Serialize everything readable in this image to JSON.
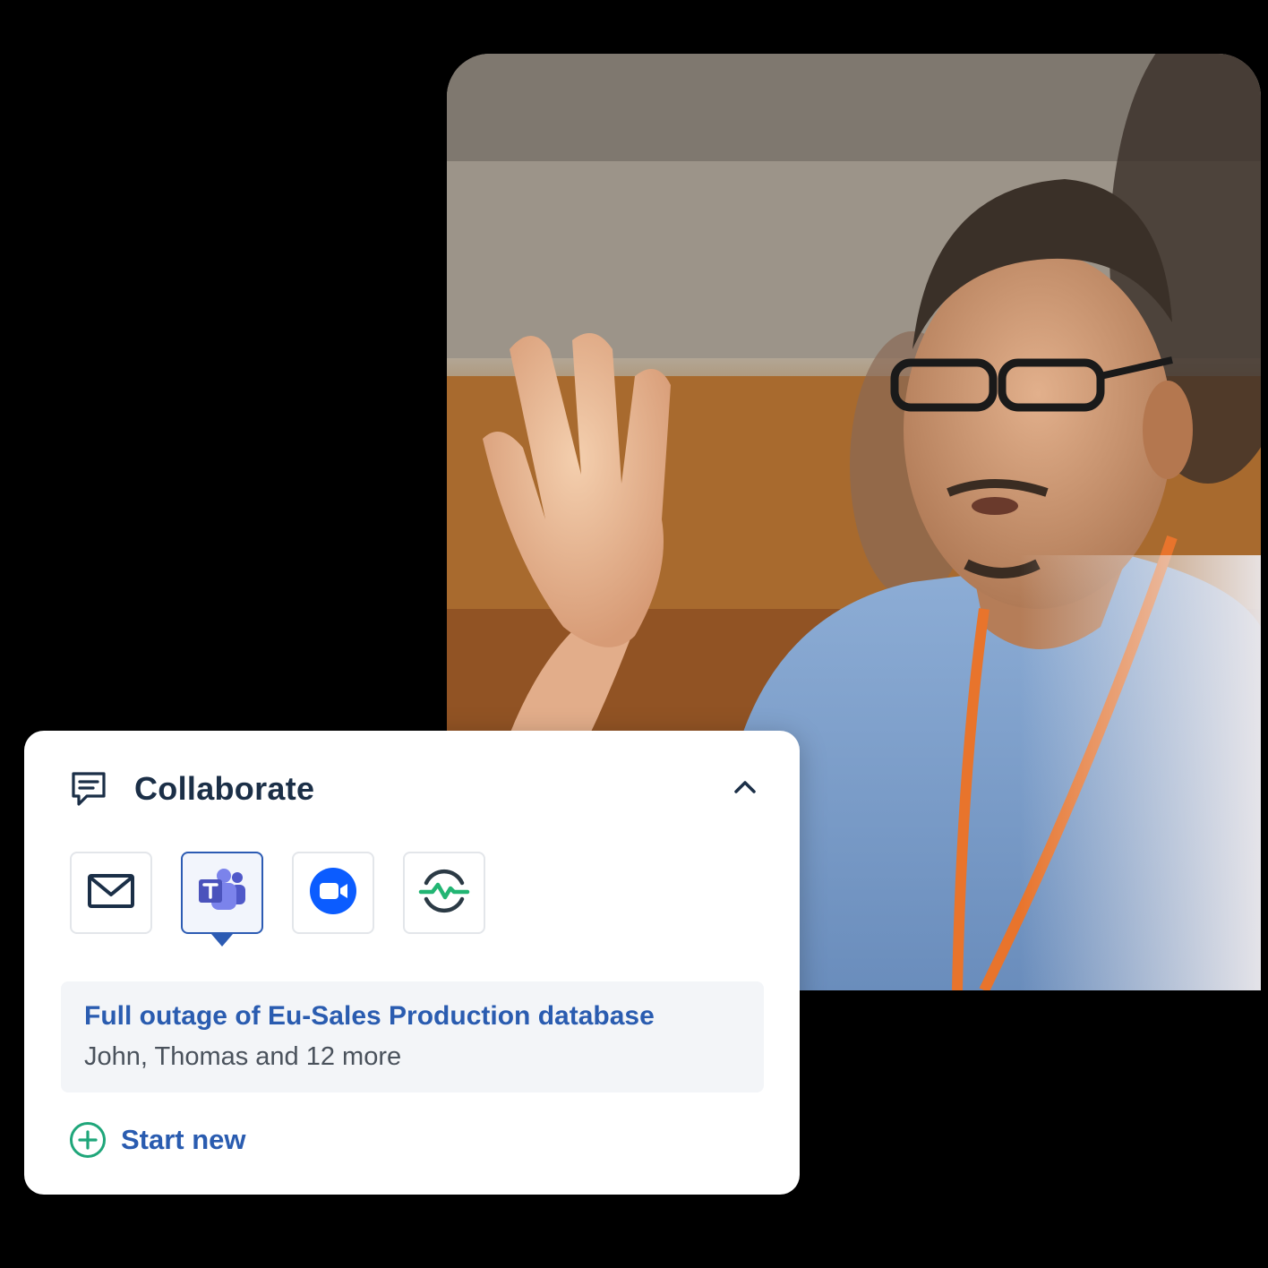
{
  "photo": {
    "subject": "person-raising-hand-photo"
  },
  "collaborate_panel": {
    "title": "Collaborate",
    "header_icon": "chat-message-icon",
    "collapse_icon": "chevron-up-icon",
    "channels": [
      {
        "name": "email",
        "icon": "envelope-icon",
        "selected": false
      },
      {
        "name": "microsoft-teams",
        "icon": "teams-icon",
        "selected": true
      },
      {
        "name": "zoom",
        "icon": "zoom-video-icon",
        "selected": false
      },
      {
        "name": "status-monitor",
        "icon": "heartbeat-icon",
        "selected": false
      }
    ],
    "incident": {
      "title": "Full outage of Eu-Sales Production database",
      "participants": "John, Thomas and 12 more"
    },
    "start_new": {
      "label": "Start new",
      "icon": "plus-circle-icon"
    }
  },
  "colors": {
    "background": "#000000",
    "card": "#ffffff",
    "title_text": "#1b2f47",
    "link_blue": "#2a5cb0",
    "selected_border": "#2c5bb3",
    "teams_purple": "#5059c9",
    "zoom_blue": "#0b5cff",
    "monitor_green": "#22b573",
    "start_new_green": "#1fa67a"
  }
}
